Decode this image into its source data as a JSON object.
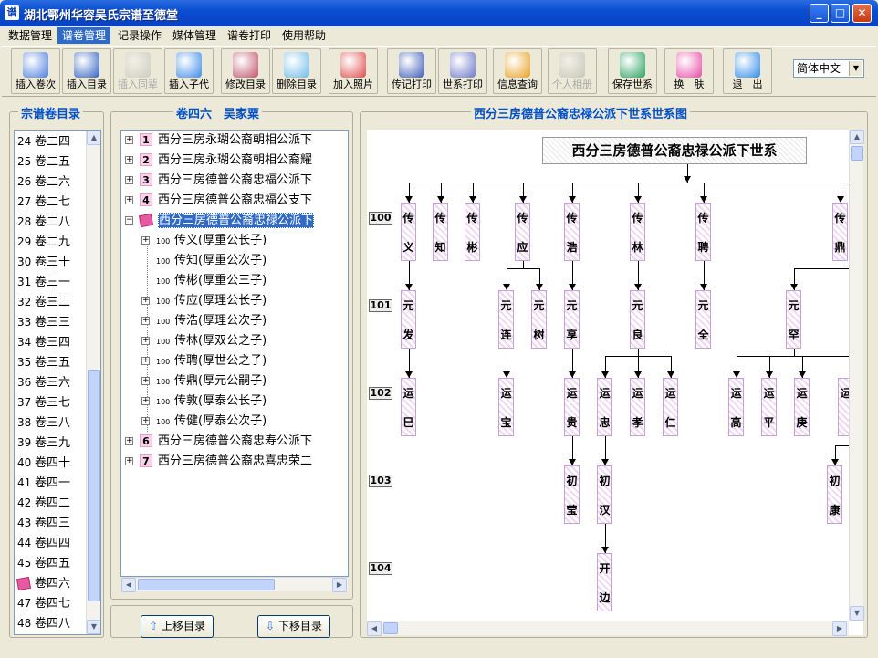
{
  "window": {
    "title": "湖北鄂州华容吴氏宗谱至德堂",
    "app_icon": "谱"
  },
  "menu": [
    "数据管理",
    "谱卷管理",
    "记录操作",
    "媒体管理",
    "谱卷打印",
    "使用帮助"
  ],
  "toolbar": [
    {
      "label": "插入卷次",
      "icon": "insert-volume-icon",
      "enabled": true
    },
    {
      "label": "插入目录",
      "icon": "insert-directory-icon",
      "enabled": true
    },
    {
      "label": "插入同辈",
      "icon": "insert-sibling-icon",
      "enabled": false
    },
    {
      "label": "插入子代",
      "icon": "insert-child-icon",
      "enabled": true
    },
    {
      "label": "修改目录",
      "icon": "edit-directory-icon",
      "enabled": true
    },
    {
      "label": "删除目录",
      "icon": "delete-directory-icon",
      "enabled": true
    },
    {
      "label": "加入照片",
      "icon": "add-photo-icon",
      "enabled": true
    },
    {
      "label": "传记打印",
      "icon": "print-biography-icon",
      "enabled": true
    },
    {
      "label": "世系打印",
      "icon": "print-lineage-icon",
      "enabled": true
    },
    {
      "label": "信息查询",
      "icon": "search-info-icon",
      "enabled": true
    },
    {
      "label": "个人相册",
      "icon": "personal-album-icon",
      "enabled": false
    },
    {
      "label": "保存世系",
      "icon": "save-lineage-icon",
      "enabled": true
    },
    {
      "label": "换　肤",
      "icon": "change-skin-icon",
      "enabled": true
    },
    {
      "label": "退　出",
      "icon": "exit-icon",
      "enabled": true
    }
  ],
  "language": {
    "selected": "简体中文"
  },
  "left_panel": {
    "title": "宗谱卷目录",
    "items": [
      {
        "num": "24",
        "label": "卷二四"
      },
      {
        "num": "25",
        "label": "卷二五"
      },
      {
        "num": "26",
        "label": "卷二六"
      },
      {
        "num": "27",
        "label": "卷二七"
      },
      {
        "num": "28",
        "label": "卷二八"
      },
      {
        "num": "29",
        "label": "卷二九"
      },
      {
        "num": "30",
        "label": "卷三十"
      },
      {
        "num": "31",
        "label": "卷三一"
      },
      {
        "num": "32",
        "label": "卷三二"
      },
      {
        "num": "33",
        "label": "卷三三"
      },
      {
        "num": "34",
        "label": "卷三四"
      },
      {
        "num": "35",
        "label": "卷三五"
      },
      {
        "num": "36",
        "label": "卷三六"
      },
      {
        "num": "37",
        "label": "卷三七"
      },
      {
        "num": "38",
        "label": "卷三八"
      },
      {
        "num": "39",
        "label": "卷三九"
      },
      {
        "num": "40",
        "label": "卷四十"
      },
      {
        "num": "41",
        "label": "卷四一"
      },
      {
        "num": "42",
        "label": "卷四二"
      },
      {
        "num": "43",
        "label": "卷四三"
      },
      {
        "num": "44",
        "label": "卷四四"
      },
      {
        "num": "45",
        "label": "卷四五"
      },
      {
        "num": "",
        "label": "卷四六",
        "selected": true
      },
      {
        "num": "47",
        "label": "卷四七"
      },
      {
        "num": "48",
        "label": "卷四八"
      }
    ]
  },
  "middle_panel": {
    "title": "卷四六　吴家粟",
    "tree": [
      {
        "badge": "1",
        "label": "西分三房永瑚公裔朝相公派下",
        "level": 0,
        "expander": "+"
      },
      {
        "badge": "2",
        "label": "西分三房永瑚公裔朝相公裔耀",
        "level": 0,
        "expander": "+"
      },
      {
        "badge": "3",
        "label": "西分三房德普公裔忠福公派下",
        "level": 0,
        "expander": "+"
      },
      {
        "badge": "4",
        "label": "西分三房德普公裔忠福公支下",
        "level": 0,
        "expander": "+"
      },
      {
        "badge": "",
        "label": "西分三房德普公裔忠禄公派下",
        "level": 0,
        "expander": "-",
        "selected": true
      },
      {
        "badge": "100",
        "label": "传义(厚重公长子)",
        "level": 1,
        "expander": "+"
      },
      {
        "badge": "100",
        "label": "传知(厚重公次子)",
        "level": 1,
        "expander": ""
      },
      {
        "badge": "100",
        "label": "传彬(厚重公三子)",
        "level": 1,
        "expander": ""
      },
      {
        "badge": "100",
        "label": "传应(厚理公长子)",
        "level": 1,
        "expander": "+"
      },
      {
        "badge": "100",
        "label": "传浩(厚理公次子)",
        "level": 1,
        "expander": "+"
      },
      {
        "badge": "100",
        "label": "传林(厚双公之子)",
        "level": 1,
        "expander": "+"
      },
      {
        "badge": "100",
        "label": "传聘(厚世公之子)",
        "level": 1,
        "expander": "+"
      },
      {
        "badge": "100",
        "label": "传鼎(厚元公嗣子)",
        "level": 1,
        "expander": "+"
      },
      {
        "badge": "100",
        "label": "传敦(厚泰公长子)",
        "level": 1,
        "expander": "+"
      },
      {
        "badge": "100",
        "label": "传健(厚泰公次子)",
        "level": 1,
        "expander": "+"
      },
      {
        "badge": "6",
        "label": "西分三房德普公裔忠寿公派下",
        "level": 0,
        "expander": "+"
      },
      {
        "badge": "7",
        "label": "西分三房德普公裔忠喜忠荣二",
        "level": 0,
        "expander": "+"
      }
    ],
    "buttons": {
      "move_up": "上移目录",
      "move_down": "下移目录"
    }
  },
  "right_panel": {
    "title": "西分三房德普公裔忠禄公派下世系世系图",
    "diagram_title": "西分三房德普公裔忠禄公派下世系",
    "generations": [
      "100",
      "101",
      "102",
      "103",
      "104"
    ],
    "persons": [
      {
        "name": "传义",
        "gen": 0
      },
      {
        "name": "传知",
        "gen": 0
      },
      {
        "name": "传彬",
        "gen": 0
      },
      {
        "name": "传应",
        "gen": 0
      },
      {
        "name": "传浩",
        "gen": 0
      },
      {
        "name": "传林",
        "gen": 0
      },
      {
        "name": "传聘",
        "gen": 0
      },
      {
        "name": "传鼎",
        "gen": 0
      },
      {
        "name": "元发",
        "gen": 1
      },
      {
        "name": "元连",
        "gen": 1
      },
      {
        "name": "元树",
        "gen": 1
      },
      {
        "name": "元享",
        "gen": 1
      },
      {
        "name": "元良",
        "gen": 1
      },
      {
        "name": "元全",
        "gen": 1
      },
      {
        "name": "元罕",
        "gen": 1
      },
      {
        "name": "运巳",
        "gen": 2
      },
      {
        "name": "运宝",
        "gen": 2
      },
      {
        "name": "运贵",
        "gen": 2
      },
      {
        "name": "运忠",
        "gen": 2
      },
      {
        "name": "运孝",
        "gen": 2
      },
      {
        "name": "运仁",
        "gen": 2
      },
      {
        "name": "运高",
        "gen": 2
      },
      {
        "name": "运平",
        "gen": 2
      },
      {
        "name": "运庚",
        "gen": 2
      },
      {
        "name": "运",
        "gen": 2
      },
      {
        "name": "初莹",
        "gen": 3
      },
      {
        "name": "初汉",
        "gen": 3
      },
      {
        "name": "初康",
        "gen": 3
      },
      {
        "name": "开边",
        "gen": 4
      }
    ]
  }
}
